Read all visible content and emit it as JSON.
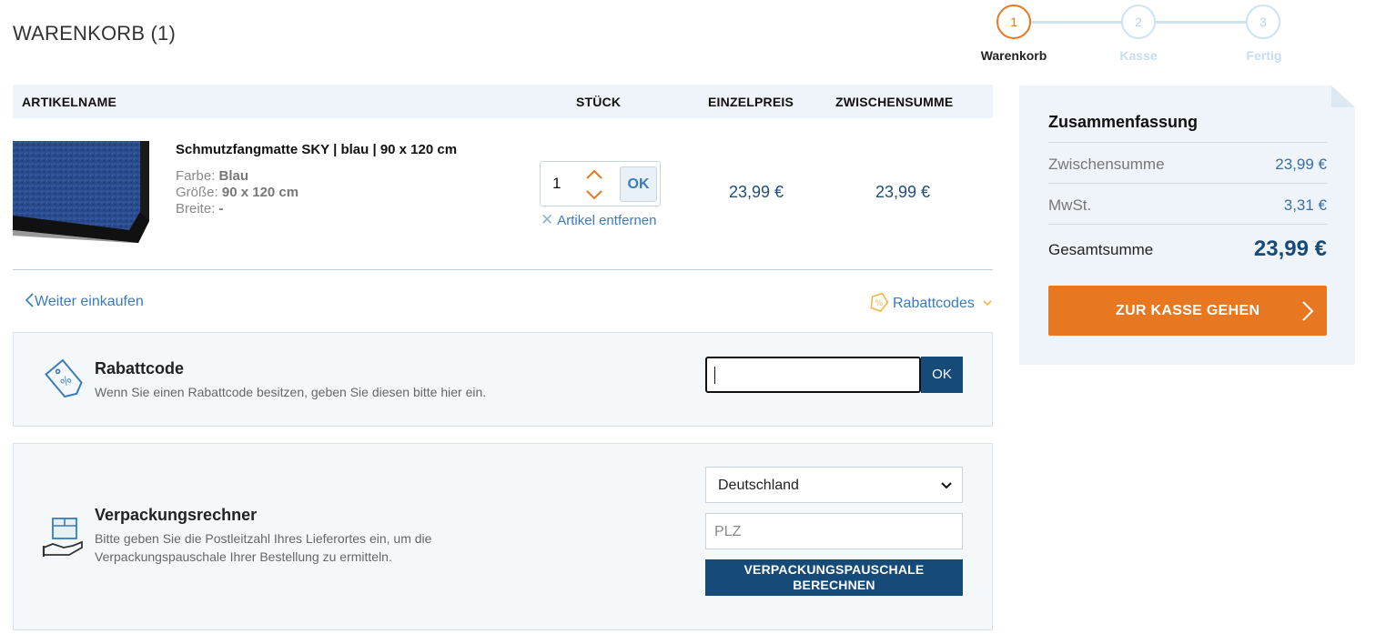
{
  "page": {
    "title": "WARENKORB (1)"
  },
  "stepper": {
    "steps": [
      {
        "number": "1",
        "label": "Warenkorb",
        "active": true
      },
      {
        "number": "2",
        "label": "Kasse",
        "active": false
      },
      {
        "number": "3",
        "label": "Fertig",
        "active": false
      }
    ]
  },
  "table": {
    "headers": [
      "ARTIKELNAME",
      "STÜCK",
      "EINZELPREIS",
      "ZWISCHENSUMME"
    ]
  },
  "item": {
    "name": "Schmutzfangmatte SKY | blau | 90 x 120 cm",
    "attrs": [
      {
        "label": "Farbe:",
        "value": "Blau"
      },
      {
        "label": "Größe:",
        "value": "90 x 120 cm"
      },
      {
        "label": "Breite:",
        "value": "-"
      }
    ],
    "quantity": "1",
    "qty_ok_label": "OK",
    "remove_label": "Artikel entfernen",
    "unit_price": "23,99 €",
    "subtotal": "23,99 €",
    "image_color": "#2a4a8e"
  },
  "links": {
    "continue_shopping": "Weiter einkaufen",
    "discount_codes": "Rabattcodes"
  },
  "coupon": {
    "title": "Rabattcode",
    "description": "Wenn Sie einen Rabattcode besitzen, geben Sie diesen bitte hier ein.",
    "input_value": "",
    "ok_label": "OK"
  },
  "packaging": {
    "title": "Verpackungsrechner",
    "description_line1": "Bitte geben Sie die Postleitzahl Ihres Lieferortes ein, um die",
    "description_line2": "Verpackungspauschale Ihrer Bestellung zu ermitteln.",
    "country_selected": "Deutschland",
    "plz_placeholder": "PLZ",
    "button_line1": "VERPACKUNGSPAUSCHALE",
    "button_line2": "BERECHNEN"
  },
  "summary": {
    "title": "Zusammenfassung",
    "subtotal_label": "Zwischensumme",
    "subtotal_value": "23,99 €",
    "tax_label": "MwSt.",
    "tax_value": "3,31 €",
    "total_label": "Gesamtsumme",
    "total_value": "23,99 €",
    "checkout_label": "ZUR KASSE GEHEN"
  },
  "colors": {
    "accent_orange": "#e87722",
    "primary_blue": "#164a78",
    "link_blue": "#3a7bbd",
    "panel_bg": "#f4f8fb"
  }
}
